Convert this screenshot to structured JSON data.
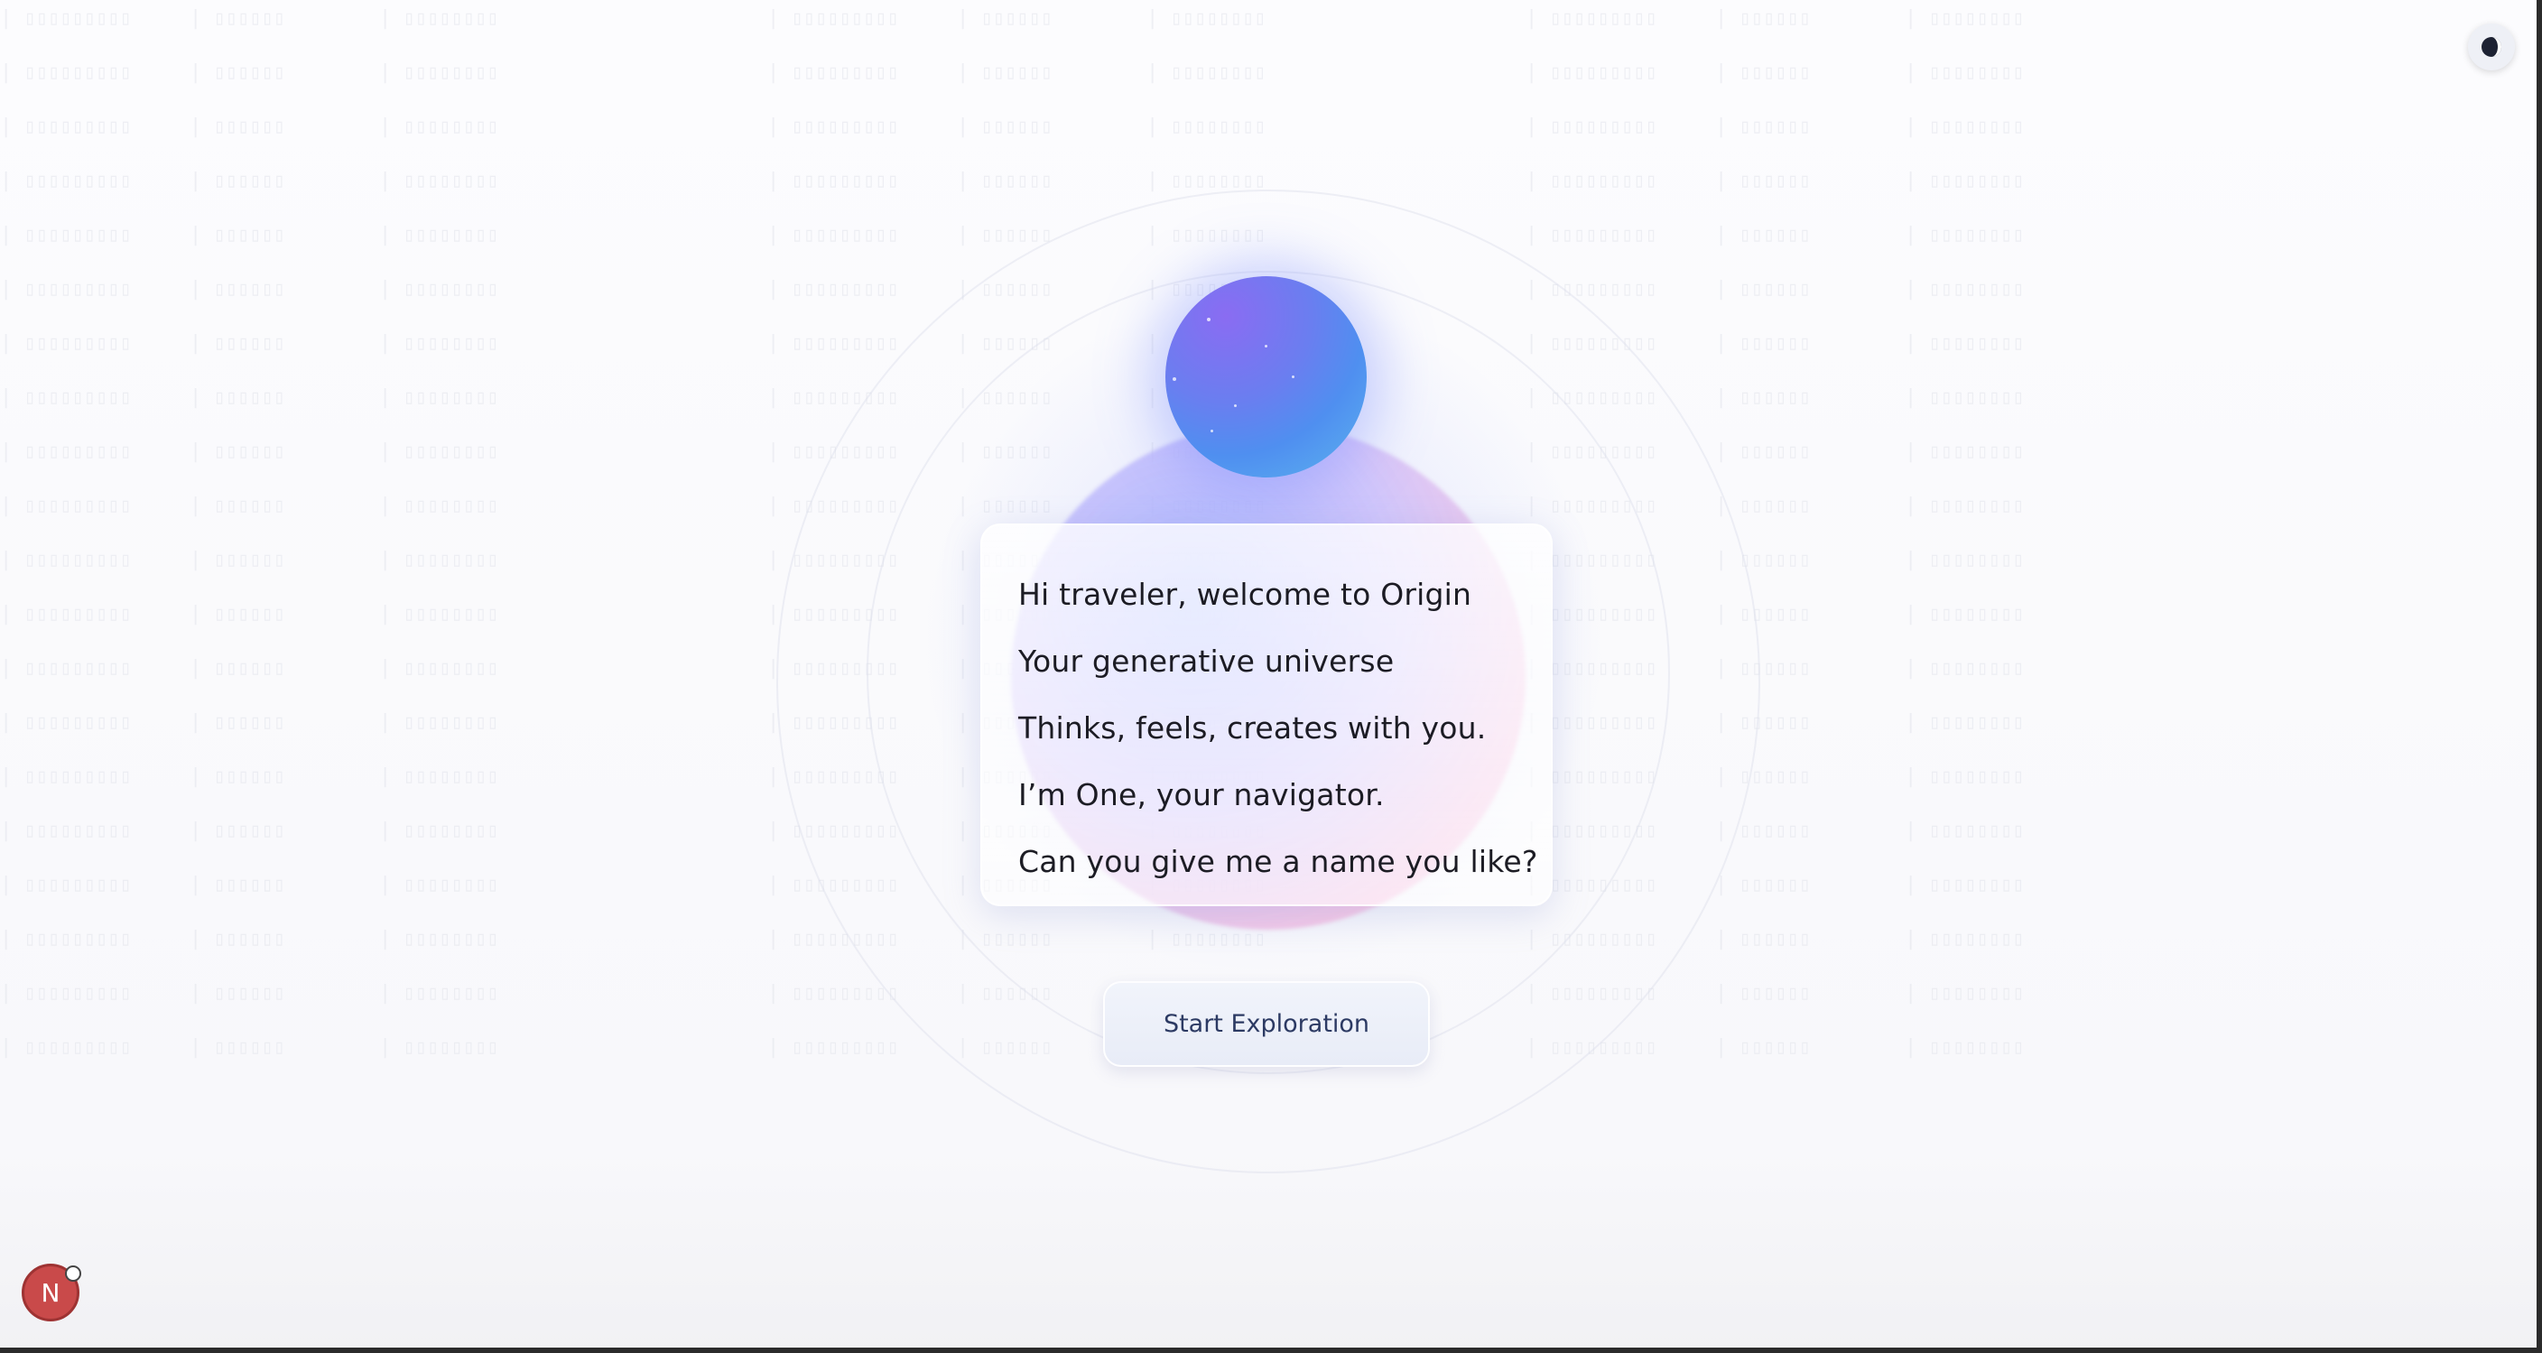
{
  "dialog": {
    "lines": [
      "Hi traveler, welcome to Origin",
      "Your generative universe",
      "Thinks, feels, creates with you.",
      "I’m One, your navigator.",
      "Can you give me a name you like?"
    ]
  },
  "actions": {
    "start_label": "Start Exploration"
  },
  "avatar": {
    "initial": "N"
  },
  "icons": {
    "theme_toggle": "half-moon-icon",
    "avatar_status": "status-dot-icon"
  },
  "colors": {
    "orb_start": "#8a6cf2",
    "orb_end": "#5db4ee",
    "avatar_bg": "#c94a4a",
    "button_text": "#2c3a63"
  }
}
